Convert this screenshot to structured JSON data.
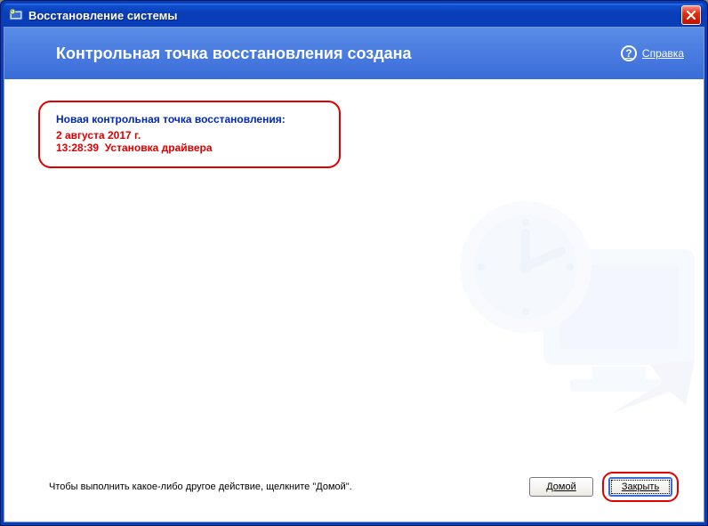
{
  "titlebar": {
    "title": "Восстановление системы"
  },
  "header": {
    "heading": "Контрольная точка восстановления создана",
    "help_label": "Справка"
  },
  "restore_point": {
    "title": "Новая контрольная точка восстановления:",
    "date": "2 августа 2017 г.",
    "time": "13:28:39",
    "description": "Установка драйвера"
  },
  "footer": {
    "hint": "Чтобы выполнить какое-либо другое действие, щелкните \"Домой\".",
    "home_label": "Домой",
    "close_label": "Закрыть"
  }
}
